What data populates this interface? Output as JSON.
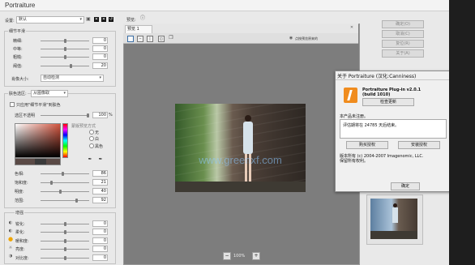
{
  "app": {
    "title": "Portraiture",
    "preset_label": "设置:",
    "preset_value": "默认"
  },
  "detail_smoothing": {
    "title": "细节平滑",
    "rows": [
      {
        "label": "精细:",
        "value": "0"
      },
      {
        "label": "中等:",
        "value": "0"
      },
      {
        "label": "粗糙:",
        "value": "0"
      },
      {
        "label": "阈值:",
        "value": "20"
      }
    ],
    "size_label": "肖像大小:",
    "size_value": "自动检测"
  },
  "skin_mask": {
    "title": "肤色选区:",
    "mode_value": "从图像取",
    "checkbox_label": "只应用\"细节平滑\"到肤色",
    "opacity_label": "选区不透明",
    "opacity_value": "100",
    "opacity_unit": "%",
    "default_label": "蒙版预览方式",
    "radio_options": [
      "无",
      "白",
      "黑色"
    ],
    "rows": [
      {
        "label": "色相:",
        "value": "86"
      },
      {
        "label": "饱和度:",
        "value": "21"
      },
      {
        "label": "明度:",
        "value": "40"
      },
      {
        "label": "范围:",
        "value": "92"
      }
    ],
    "swatch_color": "#d2553f"
  },
  "enhancements": {
    "title": "增强",
    "rows": [
      {
        "label": "锐化:",
        "value": "0"
      },
      {
        "label": "柔化:",
        "value": "0"
      },
      {
        "label": "暖和度:",
        "value": "0"
      },
      {
        "label": "亮度:",
        "value": "0"
      },
      {
        "label": "对比度:",
        "value": "0"
      }
    ]
  },
  "preview": {
    "label": "预览:",
    "tab": "预览 1",
    "split_label": "点按预览原来的",
    "zoom": "100%"
  },
  "right_buttons": [
    "确定(O)",
    "取消(C)",
    "复位(R)",
    "关于(A)"
  ],
  "about": {
    "title": "关于 Portraiture (汉化:Canniness)",
    "product": "Portraiture Plug-in v2.0.1",
    "build": "(build 1010)",
    "check_update": "检查更新",
    "registration_header": "本产品未注册。",
    "trial_text": "评估期将在 24785 天后结束。",
    "buy_button": "购买授权",
    "install_button": "安装授权",
    "copyright": "版本所有 (c) 2004-2007 Imagenomic, LLC.",
    "rights": "保留所有权利。",
    "ok_button": "确定"
  },
  "watermark": "www.greenxf.com",
  "colors": {
    "accent": "#f08c1e",
    "window_bg": "#e9e9e9"
  }
}
